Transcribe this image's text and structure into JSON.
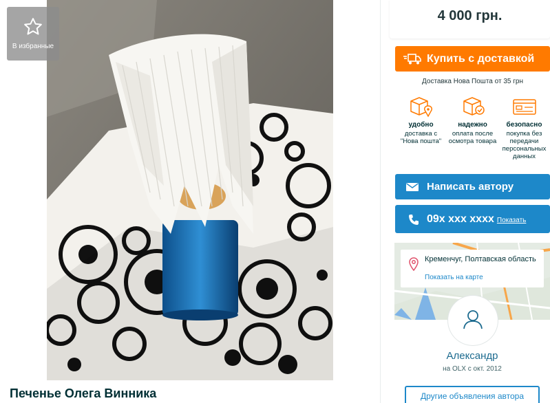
{
  "favorite": {
    "label": "В избранные",
    "icon": "star-outline-icon"
  },
  "listing": {
    "title": "Печенье Олега Винника",
    "price": "4 000 грн."
  },
  "buy": {
    "label": "Купить с доставкой",
    "icon": "truck-icon",
    "color": "#ff7a00"
  },
  "delivery": {
    "note": "Доставка Нова Пошта от 35 грн"
  },
  "features": [
    {
      "title": "удобно",
      "desc": "доставка с \"Нова пошта\"",
      "icon": "box-location-icon"
    },
    {
      "title": "надежно",
      "desc": "оплата после осмотра товара",
      "icon": "box-check-icon"
    },
    {
      "title": "безопасно",
      "desc": "покупка без передачи персональных данных",
      "icon": "card-icon"
    }
  ],
  "message": {
    "label": "Написать автору",
    "icon": "mail-icon",
    "color": "#1d88c9"
  },
  "phone": {
    "number": "09x xxx xxxx",
    "show_label": "Показать",
    "icon": "phone-icon"
  },
  "location": {
    "city": "Кременчуг, Полтавская область",
    "map_link": "Показать на карте",
    "icon": "map-pin-icon"
  },
  "seller": {
    "name": "Александр",
    "since": "на OLX с окт. 2012",
    "icon": "user-icon"
  },
  "other_ads": {
    "label": "Другие объявления автора"
  }
}
